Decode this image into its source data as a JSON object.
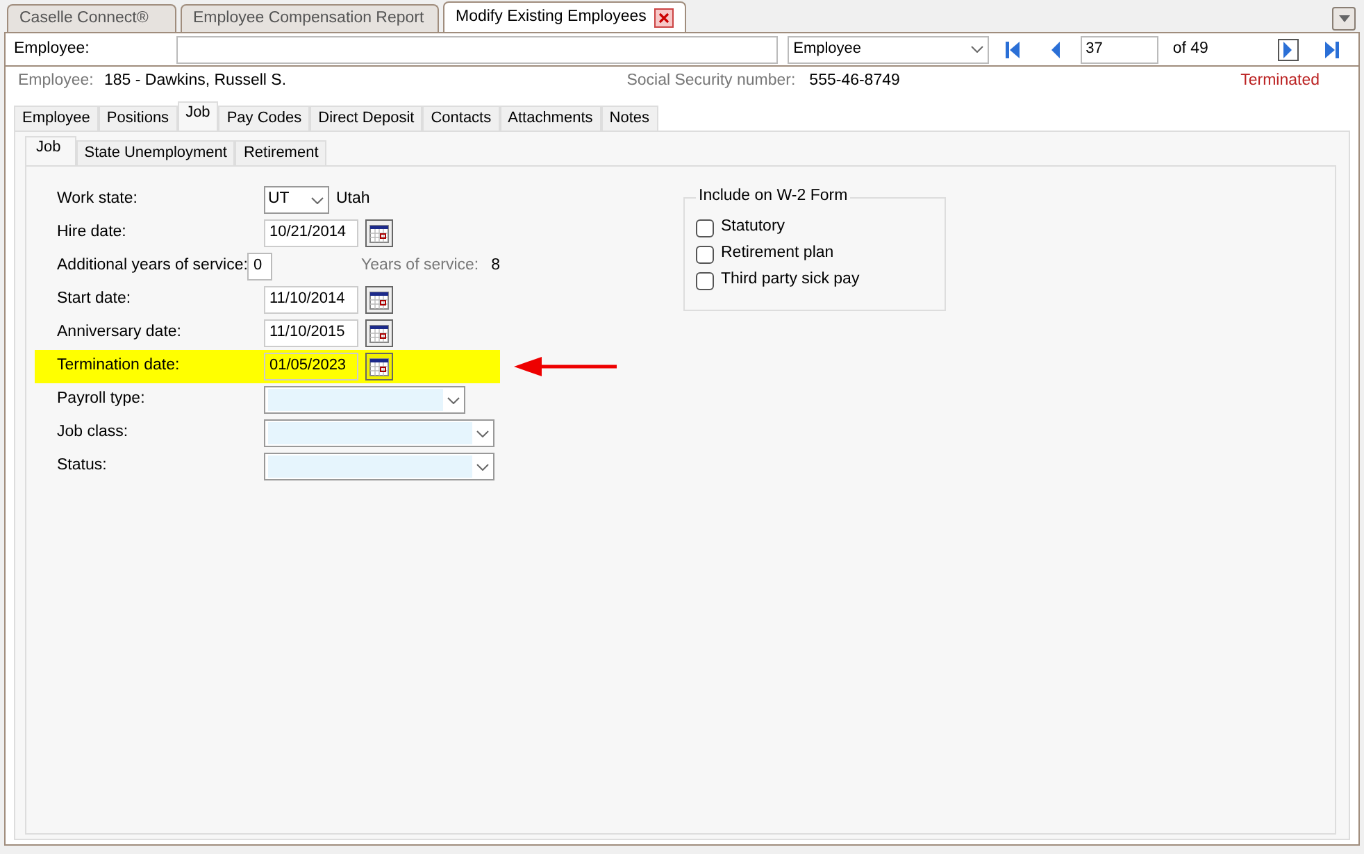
{
  "window_tabs": [
    {
      "label": "Caselle Connect®",
      "selected": false,
      "closable": false
    },
    {
      "label": "Employee Compensation Report",
      "selected": false,
      "closable": false
    },
    {
      "label": "Modify Existing Employees",
      "selected": true,
      "closable": true
    }
  ],
  "lookup": {
    "label": "Employee:",
    "search_by": "Employee",
    "record": "37",
    "of_total": "of 49"
  },
  "employee_info": {
    "employee_label": "Employee:",
    "employee": "185 - Dawkins, Russell S.",
    "ssn_label": "Social Security number:",
    "ssn": "555-46-8749",
    "status": "Terminated"
  },
  "tabs": [
    {
      "label": "Employee",
      "selected": false
    },
    {
      "label": "Positions",
      "selected": false
    },
    {
      "label": "Job",
      "selected": true
    },
    {
      "label": "Pay Codes",
      "selected": false
    },
    {
      "label": "Direct Deposit",
      "selected": false
    },
    {
      "label": "Contacts",
      "selected": false
    },
    {
      "label": "Attachments",
      "selected": false
    },
    {
      "label": "Notes",
      "selected": false
    }
  ],
  "subtabs": [
    {
      "label": "Job",
      "selected": true
    },
    {
      "label": "State Unemployment",
      "selected": false
    },
    {
      "label": "Retirement",
      "selected": false
    }
  ],
  "fields": [
    {
      "kind": "state",
      "label": "Work state:",
      "value": "UT",
      "extra": "Utah",
      "highlighted": false
    },
    {
      "kind": "date",
      "label": "Hire date:",
      "value": "10/21/2014",
      "highlighted": false
    },
    {
      "kind": "number",
      "label": "Additional years of service:",
      "value": "0",
      "extra_label": "Years of service:",
      "extra": "8",
      "highlighted": false
    },
    {
      "kind": "date",
      "label": "Start date:",
      "value": "11/10/2014",
      "highlighted": false
    },
    {
      "kind": "date",
      "label": "Anniversary date:",
      "value": "11/10/2015",
      "highlighted": false
    },
    {
      "kind": "date",
      "label": "Termination date:",
      "value": "01/05/2023",
      "highlighted": true
    },
    {
      "kind": "short_select",
      "label": "Payroll type:",
      "highlighted": false
    },
    {
      "kind": "select",
      "label": "Job class:",
      "highlighted": false
    },
    {
      "kind": "select",
      "label": "Status:",
      "highlighted": false
    }
  ],
  "w2_group": {
    "title": "Include on W-2 Form",
    "options": [
      {
        "label": "Statutory",
        "checked": false
      },
      {
        "label": "Retirement plan",
        "checked": false
      },
      {
        "label": "Third party sick pay",
        "checked": false
      }
    ]
  }
}
